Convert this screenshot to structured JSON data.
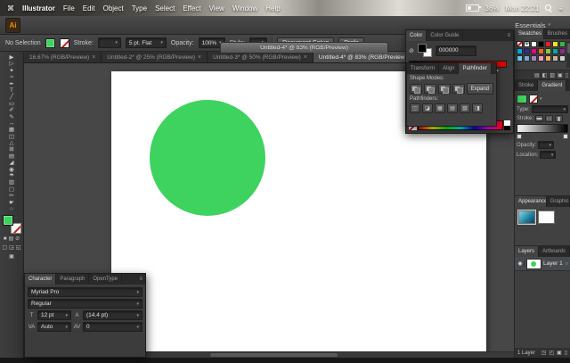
{
  "glyphs": {
    "apple": "⌘",
    "dropdown": "▾",
    "menu": "≡",
    "close": "×",
    "none": "⊘",
    "eye": "◉",
    "target": "○"
  },
  "menu_bar": {
    "items": [
      "Illustrator",
      "File",
      "Edit",
      "Object",
      "Type",
      "Select",
      "Effect",
      "View",
      "Window",
      "Help"
    ],
    "battery": "36%",
    "clock": "Mon 22:21"
  },
  "app_bar": {
    "logo": "Ai",
    "workspace": "Essentials"
  },
  "control_bar": {
    "no_selection": "No Selection",
    "stroke_label": "Stroke:",
    "brush": "5 pt. Flat",
    "opacity_label": "Opacity:",
    "opacity_value": "100%",
    "style_label": "Style:",
    "document_setup": "Document Setup",
    "preferences": "Prefe",
    "fill_color": "#3ed35f"
  },
  "window_title": "Untitled-4* @ 83% (RGB/Preview)",
  "document_tabs": [
    {
      "label": "16.67% (RGB/Preview)",
      "active": false
    },
    {
      "label": "Untitled-2* @ 25% (RGB/Preview)",
      "active": false
    },
    {
      "label": "Untitled-3* @ 50% (RGB/Preview)",
      "active": false
    },
    {
      "label": "Untitled-4* @ 83% (RGB/Preview)",
      "active": true
    }
  ],
  "tools": [
    {
      "name": "selection",
      "glyph": "▶"
    },
    {
      "name": "direct-selection",
      "glyph": "▷"
    },
    {
      "name": "magic-wand",
      "glyph": "✦"
    },
    {
      "name": "lasso",
      "glyph": "≈"
    },
    {
      "name": "pen",
      "glyph": "✒"
    },
    {
      "name": "type",
      "glyph": "T"
    },
    {
      "name": "line-segment",
      "glyph": "╱"
    },
    {
      "name": "rectangle",
      "glyph": "▭"
    },
    {
      "name": "paintbrush",
      "glyph": "✐"
    },
    {
      "name": "pencil",
      "glyph": "✎"
    },
    {
      "name": "width",
      "glyph": "↔"
    },
    {
      "name": "free-transform",
      "glyph": "▦"
    },
    {
      "name": "shape-builder",
      "glyph": "◫"
    },
    {
      "name": "perspective-grid",
      "glyph": "△"
    },
    {
      "name": "mesh",
      "glyph": "⊞"
    },
    {
      "name": "gradient",
      "glyph": "▤"
    },
    {
      "name": "eyedropper",
      "glyph": "◢"
    },
    {
      "name": "blend",
      "glyph": "◉"
    },
    {
      "name": "symbol-sprayer",
      "glyph": "☂"
    },
    {
      "name": "column-graph",
      "glyph": "▥"
    },
    {
      "name": "artboard",
      "glyph": "▢"
    },
    {
      "name": "slice",
      "glyph": "✂"
    },
    {
      "name": "hand",
      "glyph": "☛"
    },
    {
      "name": "zoom",
      "glyph": "○"
    }
  ],
  "toolbar_extras": [
    {
      "name": "fill-color-button",
      "glyph": "■"
    },
    {
      "name": "gradient-button",
      "glyph": "▤"
    },
    {
      "name": "none-button",
      "glyph": "⊘"
    },
    {
      "name": "draw-normal-mode",
      "glyph": "▢"
    },
    {
      "name": "draw-behind-mode",
      "glyph": "◲"
    },
    {
      "name": "draw-inside-mode",
      "glyph": "◱"
    },
    {
      "name": "screen-mode",
      "glyph": "▣"
    }
  ],
  "artboard": {
    "circle_color": "#3ed35f"
  },
  "color_panel": {
    "tabs": [
      "Color",
      "Color Guide"
    ],
    "hex": "000000"
  },
  "pathfinder_panel": {
    "tabs": [
      "Transform",
      "Align",
      "Pathfinder"
    ],
    "shape_modes_label": "Shape Modes:",
    "expand_label": "Expand",
    "pathfinders_label": "Pathfinders:",
    "shape_mode_names": [
      "unite",
      "minus-front",
      "intersect",
      "exclude"
    ],
    "buttons": [
      {
        "name": "divide",
        "glyph": "◫"
      },
      {
        "name": "trim",
        "glyph": "◪"
      },
      {
        "name": "merge",
        "glyph": "▦"
      },
      {
        "name": "crop",
        "glyph": "▤"
      },
      {
        "name": "outline",
        "glyph": "▧"
      },
      {
        "name": "minus-back",
        "glyph": "◨"
      }
    ]
  },
  "character_panel": {
    "tabs": [
      "Character",
      "Paragraph",
      "OpenType"
    ],
    "font_family": "Myriad Pro",
    "font_style": "Regular",
    "size": "12 pt",
    "leading": "(14.4 pt)",
    "kerning": "Auto",
    "tracking": "0"
  },
  "dock": {
    "swatches": {
      "tabs": [
        "Swatches",
        "Brushes"
      ],
      "colors": [
        "#ffffff",
        "#ffffff",
        "#ffffff",
        "#000000",
        "#ed1c24",
        "#ffde17",
        "#39b54a",
        "#00aeef",
        "#2e3192",
        "#ec008c",
        "#f26522",
        "#8dc63f",
        "#00a99d",
        "#92278f",
        "#6dcff6",
        "#7da7d9",
        "#a186be",
        "#f49ac1",
        "#fbaf5d",
        "#c7b299",
        "#d1d3d4"
      ],
      "footer_icons": [
        {
          "name": "swatch-libraries",
          "glyph": "▤"
        },
        {
          "name": "swatch-kinds",
          "glyph": "◧"
        },
        {
          "name": "swatch-options",
          "glyph": "▥"
        },
        {
          "name": "new-swatch",
          "glyph": "▣"
        },
        {
          "name": "delete-swatch",
          "glyph": "▯"
        }
      ]
    },
    "gradient": {
      "tabs": [
        "Stroke",
        "Gradient"
      ],
      "type_label": "Type:",
      "stroke_label": "Stroke:",
      "opacity_label": "Opacity:",
      "location_label": "Location:",
      "stroke_icons": [
        {
          "name": "gradient-within-stroke",
          "glyph": "▬"
        },
        {
          "name": "gradient-along-stroke",
          "glyph": "▭"
        },
        {
          "name": "gradient-across-stroke",
          "glyph": "▮"
        }
      ]
    },
    "styles": {
      "tabs": [
        "Appearance",
        "Graphic"
      ]
    },
    "layers": {
      "tabs": [
        "Layers",
        "Artboards"
      ],
      "layer_name": "Layer 1",
      "count": "1 Layer",
      "footer_icons": [
        {
          "name": "make-clipping-mask",
          "glyph": "◳"
        },
        {
          "name": "new-sublayer",
          "glyph": "◰"
        },
        {
          "name": "new-layer",
          "glyph": "▣"
        },
        {
          "name": "delete-layer",
          "glyph": "▯"
        }
      ]
    }
  }
}
